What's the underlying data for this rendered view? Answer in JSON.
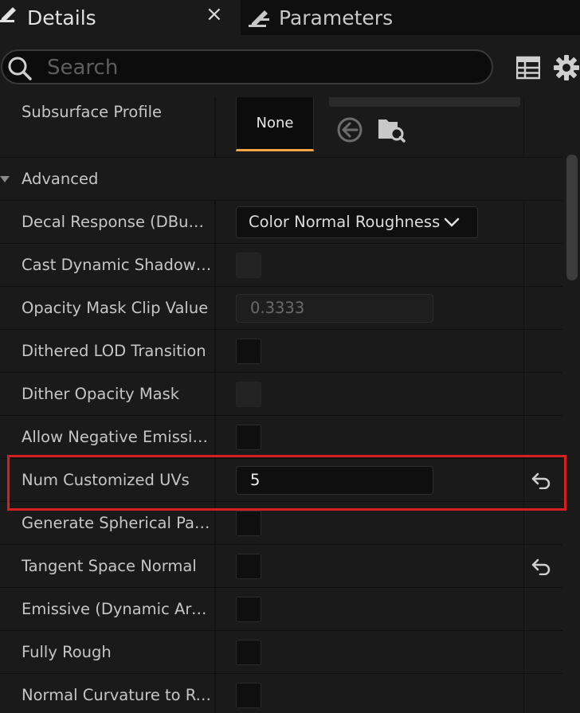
{
  "tabs": [
    {
      "label": "Details",
      "close": "×",
      "icon": "pencil-edit-icon"
    },
    {
      "label": "Parameters",
      "icon": "pencil-edit-icon"
    }
  ],
  "search": {
    "placeholder": "Search",
    "value": ""
  },
  "toolbar": {
    "icons": [
      "table-view-icon",
      "gear-icon"
    ]
  },
  "subsurface": {
    "label": "Subsurface Profile",
    "thumbnail_text": "None"
  },
  "category": {
    "label": "Advanced",
    "expanded": true
  },
  "properties": [
    {
      "label": "Decal Response (DBuffer)",
      "type": "dropdown",
      "value": "Color Normal Roughness"
    },
    {
      "label": "Cast Dynamic Shadow…",
      "type": "checkbox",
      "checked": false,
      "disabled": true
    },
    {
      "label": "Opacity Mask Clip Value",
      "type": "number",
      "value": "0.3333",
      "disabled": true
    },
    {
      "label": "Dithered LOD Transition",
      "type": "checkbox",
      "checked": false,
      "disabled": false
    },
    {
      "label": "Dither Opacity Mask",
      "type": "checkbox",
      "checked": false,
      "disabled": true
    },
    {
      "label": "Allow Negative Emissiv…",
      "type": "checkbox",
      "checked": false,
      "disabled": false
    },
    {
      "label": "Num Customized UVs",
      "type": "number",
      "value": "5",
      "disabled": false,
      "reset": true,
      "highlighted": true
    },
    {
      "label": "Generate Spherical Parti…",
      "type": "checkbox",
      "checked": false,
      "disabled": false
    },
    {
      "label": "Tangent Space Normal",
      "type": "checkbox",
      "checked": false,
      "disabled": false,
      "reset": true
    },
    {
      "label": "Emissive (Dynamic Area…",
      "type": "checkbox",
      "checked": false,
      "disabled": false
    },
    {
      "label": "Fully Rough",
      "type": "checkbox",
      "checked": false,
      "disabled": false
    },
    {
      "label": "Normal Curvature to Ro…",
      "type": "checkbox",
      "checked": false,
      "disabled": false
    }
  ],
  "colors": {
    "accent_orange": "#f3a446",
    "highlight_red": "#d42020",
    "panel_bg": "#1a1a1a",
    "field_bg": "#0f0f0f"
  }
}
